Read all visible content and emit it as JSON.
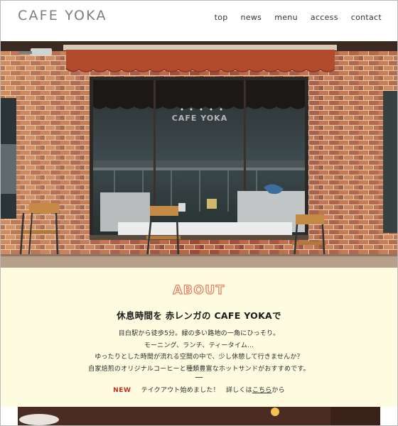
{
  "header": {
    "logo": "CAFE YOKA",
    "nav": [
      "top",
      "news",
      "menu",
      "access",
      "contact"
    ]
  },
  "hero": {
    "window_sign": "CAFE YOKA",
    "colors": {
      "brick": "#a8543b",
      "awning": "#b24a2c",
      "window": "#1f2a2e"
    }
  },
  "about": {
    "title": "ABOUT",
    "tagline": "休息時間を 赤レンガの CAFE YOKAで",
    "lines": [
      "目白駅から徒歩5分。緑の多い路地の一角にひっそり。",
      "モーニング、ランチ、ティータイム…",
      "ゆったりとした時間が流れる空間の中で、少し休憩して行きませんか？",
      "自家焙煎のオリジナルコーヒーと種類豊富なホットサンドがおすすめです。"
    ],
    "news": {
      "badge": "NEW",
      "text_before": "テイクアウト始めました！　詳しくは",
      "link": "こちら",
      "text_after": "から"
    },
    "colors": {
      "background": "#fdfce0",
      "title_outline": "#e0866c",
      "badge": "#c4281f"
    }
  }
}
